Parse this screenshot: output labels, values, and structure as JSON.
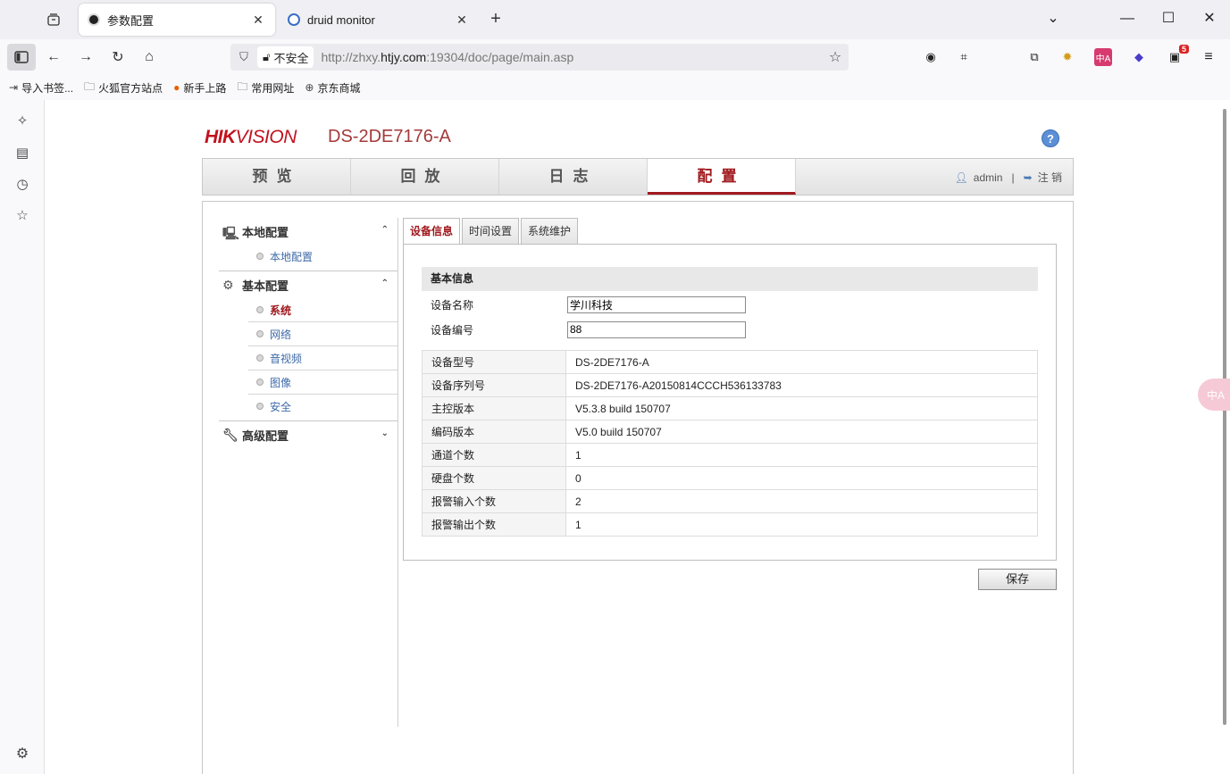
{
  "browser": {
    "tabs": [
      {
        "title": "参数配置",
        "close": "✕"
      },
      {
        "title": "druid monitor",
        "close": "✕"
      }
    ],
    "new_tab": "+",
    "window_controls": {
      "minimize": "—",
      "maximize": "☐",
      "close": "✕",
      "list": "⌄"
    },
    "security_label": "不安全",
    "url_prefix": "http://zhxy.",
    "url_domain": "htjy.com",
    "url_suffix": ":19304/doc/page/main.asp",
    "extension_badge": "5",
    "bookmarks": [
      {
        "label": "导入书签...",
        "icon": "import-icon"
      },
      {
        "label": "火狐官方站点",
        "icon": "folder-icon"
      },
      {
        "label": "新手上路",
        "icon": "firefox-icon"
      },
      {
        "label": "常用网址",
        "icon": "folder-icon"
      },
      {
        "label": "京东商城",
        "icon": "globe-icon"
      }
    ],
    "floating_translate": "中A"
  },
  "header": {
    "logo_brand": "HIK",
    "logo_vision": "VISION",
    "model": "DS-2DE7176-A",
    "help": "?"
  },
  "mainnav": {
    "items": [
      "预览",
      "回放",
      "日志",
      "配置"
    ],
    "active_index": 3,
    "user": "admin",
    "separator": "|",
    "logout": "注 销"
  },
  "menu": {
    "groups": [
      {
        "label": "本地配置",
        "chevron": "⌃",
        "subs": [
          "本地配置"
        ]
      },
      {
        "label": "基本配置",
        "chevron": "⌃",
        "subs": [
          "系统",
          "网络",
          "音视频",
          "图像",
          "安全"
        ]
      },
      {
        "label": "高级配置",
        "chevron": "⌄",
        "subs": []
      }
    ],
    "active_sub": "系统"
  },
  "tabs": [
    "设备信息",
    "时间设置",
    "系统维护"
  ],
  "active_tab": 0,
  "basic_info": {
    "section_title": "基本信息",
    "device_name_label": "设备名称",
    "device_name_value": "学川科技",
    "device_no_label": "设备编号",
    "device_no_value": "88"
  },
  "info_table": [
    {
      "k": "设备型号",
      "v": "DS-2DE7176-A"
    },
    {
      "k": "设备序列号",
      "v": "DS-2DE7176-A20150814CCCH536133783"
    },
    {
      "k": "主控版本",
      "v": "V5.3.8 build 150707"
    },
    {
      "k": "编码版本",
      "v": "V5.0 build 150707"
    },
    {
      "k": "通道个数",
      "v": "1"
    },
    {
      "k": "硬盘个数",
      "v": "0"
    },
    {
      "k": "报警输入个数",
      "v": "2"
    },
    {
      "k": "报警输出个数",
      "v": "1"
    }
  ],
  "save_label": "保存",
  "colors": {
    "accent": "#a0191e",
    "link": "#3f6aa8",
    "brand": "#c1121f"
  }
}
